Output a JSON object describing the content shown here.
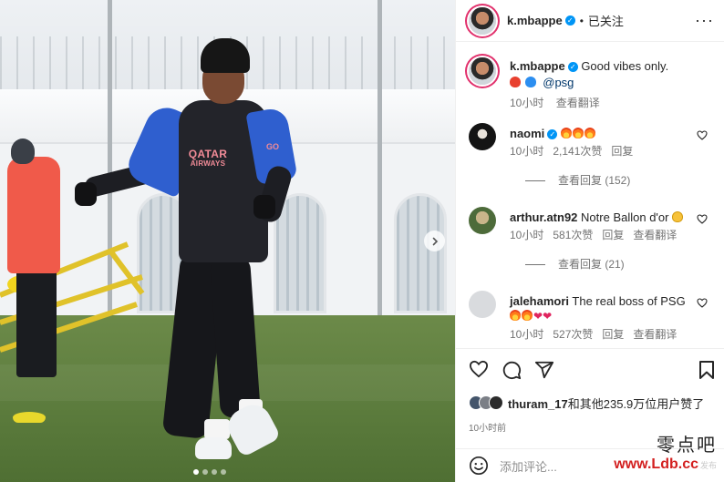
{
  "header": {
    "username": "k.mbappe",
    "separator": "•",
    "follow_status": "已关注",
    "more": "···"
  },
  "photo": {
    "jersey_line1": "QATAR",
    "jersey_line2": "AIRWAYS",
    "jersey_right": "GO",
    "carousel_dots": 4,
    "active_dot": 1
  },
  "caption": {
    "username": "k.mbappe",
    "text": "Good vibes only.",
    "mention": "@psg",
    "time": "10小时",
    "translate": "查看翻译"
  },
  "comments": [
    {
      "username": "naomi",
      "verified": true,
      "text": "",
      "emoji": [
        "fire",
        "fire",
        "fire"
      ],
      "time": "10小时",
      "likes": "2,141次赞",
      "reply": "回复",
      "translate": "",
      "replies": "查看回复 (152)"
    },
    {
      "username": "arthur.atn92",
      "verified": false,
      "text": "Notre Ballon d'or",
      "emoji": [
        "smile"
      ],
      "time": "10小时",
      "likes": "581次赞",
      "reply": "回复",
      "translate": "查看翻译",
      "replies": "查看回复 (21)"
    },
    {
      "username": "jalehamori",
      "verified": false,
      "text": "The real boss of PSG",
      "emoji": [
        "fire",
        "fire",
        "heart",
        "heart"
      ],
      "time": "10小时",
      "likes": "527次赞",
      "reply": "回复",
      "translate": "查看翻译",
      "replies": ""
    }
  ],
  "likes": {
    "first_user": "thuram_17",
    "rest": "和其他235.9万位用户赞了"
  },
  "post_time": "10小时前",
  "add_comment": {
    "placeholder": "添加评论..."
  },
  "watermark": {
    "chinese": "零点吧",
    "url": "www.Ldb.cc",
    "faint": "发布"
  },
  "colors": {
    "verified": "#0095f6",
    "ring": "#e1306c",
    "muted": "#737373"
  }
}
